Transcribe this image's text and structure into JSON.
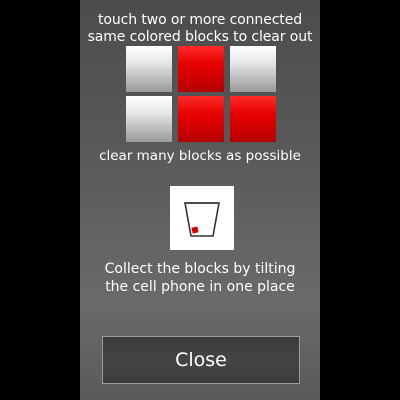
{
  "instructions": {
    "line1": "touch two or more connected",
    "line2": "same colored blocks to clear out",
    "clear_many": "clear many blocks as possible",
    "tilt_line1": "Collect the blocks by tilting",
    "tilt_line2": "the cell phone in one place"
  },
  "example_grid": {
    "rows": [
      [
        "gray",
        "red",
        "gray"
      ],
      [
        "gray",
        "red",
        "red"
      ]
    ],
    "colors": {
      "gray": "#d0d0d0",
      "red": "#e00000"
    }
  },
  "tilt_illustration": {
    "icon": "cup-with-block-icon",
    "block_color": "#e00000"
  },
  "close_button": {
    "label": "Close"
  }
}
